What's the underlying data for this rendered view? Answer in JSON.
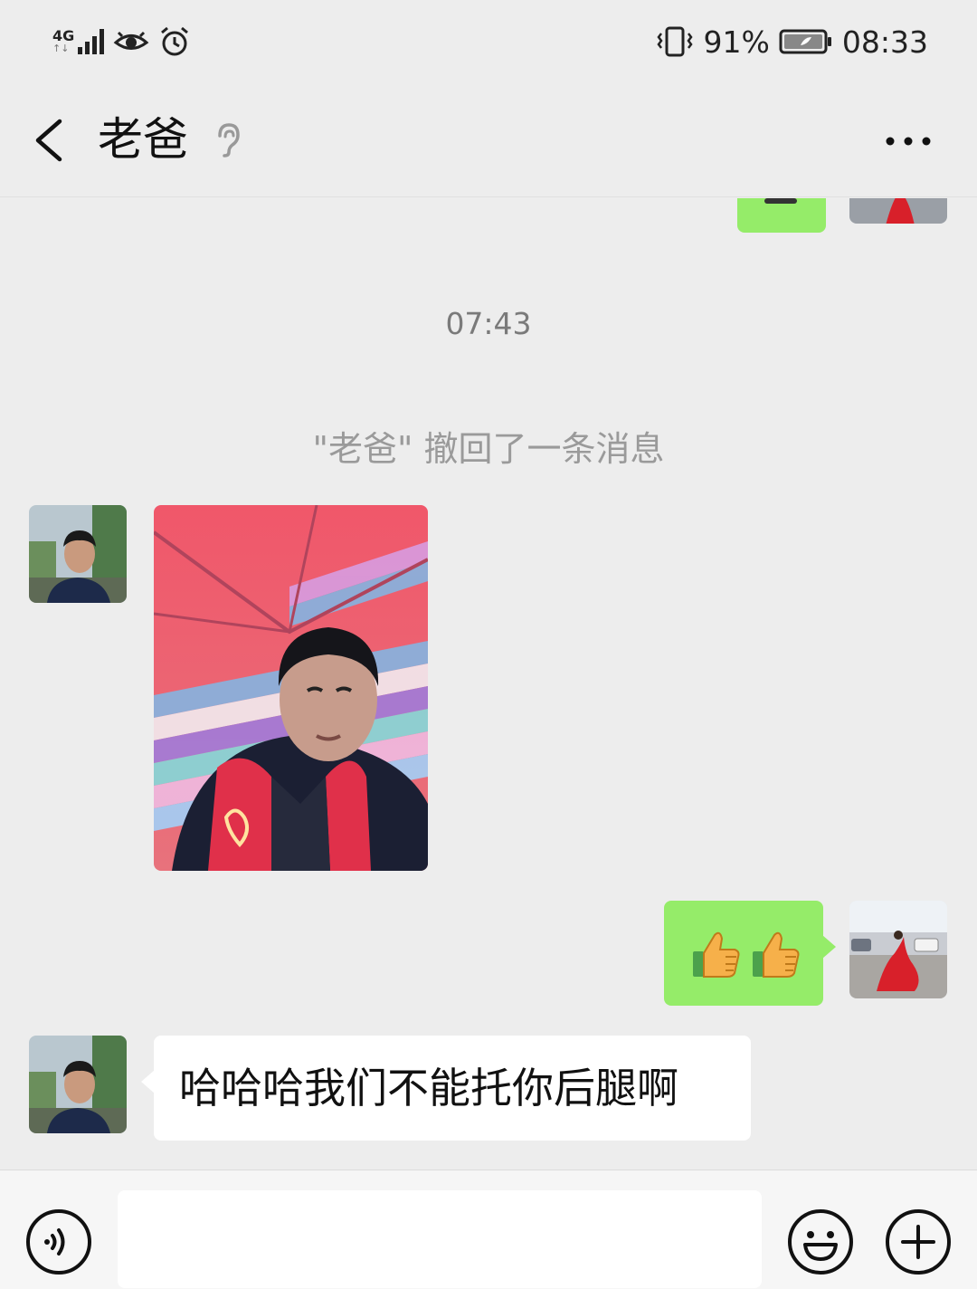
{
  "status_bar": {
    "network": "4G",
    "battery": "91%",
    "time": "08:33",
    "icons": [
      "signal-icon",
      "eye-icon",
      "alarm-icon",
      "vibrate-icon",
      "battery-icon"
    ]
  },
  "header": {
    "title": "老爸",
    "icons": [
      "back-arrow-icon",
      "ear-icon",
      "more-icon"
    ]
  },
  "messages": [
    {
      "type": "image",
      "side": "right",
      "sender": "me",
      "cropped": true
    },
    {
      "type": "time",
      "text": "07:43"
    },
    {
      "type": "system",
      "text": "\"老爸\" 撤回了一条消息"
    },
    {
      "type": "image",
      "side": "left",
      "sender": "老爸"
    },
    {
      "type": "emoji",
      "side": "right",
      "sender": "me",
      "emojis": [
        "thumbs-up-icon",
        "thumbs-up-icon"
      ]
    },
    {
      "type": "text",
      "side": "left",
      "sender": "老爸",
      "text": "哈哈哈我们不能托你后腿啊"
    }
  ],
  "colors": {
    "background": "#ededed",
    "outgoing_bubble": "#95ec69",
    "incoming_bubble": "#ffffff",
    "system_text": "#9a9a9a"
  },
  "input_bar": {
    "value": "",
    "icons": [
      "voice-icon",
      "emoji-face-icon",
      "plus-icon"
    ]
  }
}
